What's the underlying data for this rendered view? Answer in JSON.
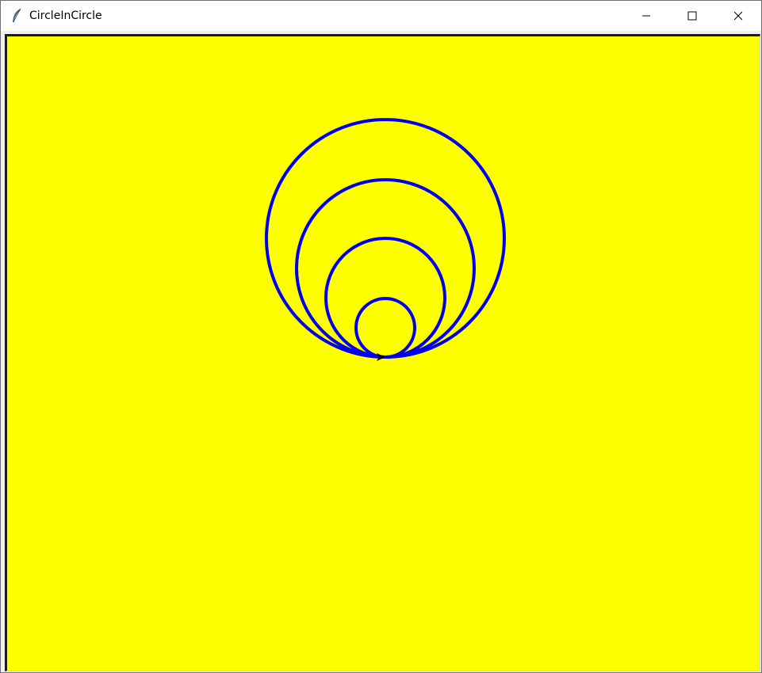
{
  "window": {
    "title": "CircleInCircle",
    "app_icon": "feather-icon"
  },
  "controls": {
    "minimize_icon": "minimize-icon",
    "maximize_icon": "maximize-icon",
    "close_icon": "close-icon"
  },
  "canvas": {
    "background_color": "#ffff00",
    "stroke_color": "#0000ee",
    "circle_radii": [
      150,
      112,
      75,
      37
    ],
    "turtle_icon": "turtle-arrow-icon"
  }
}
